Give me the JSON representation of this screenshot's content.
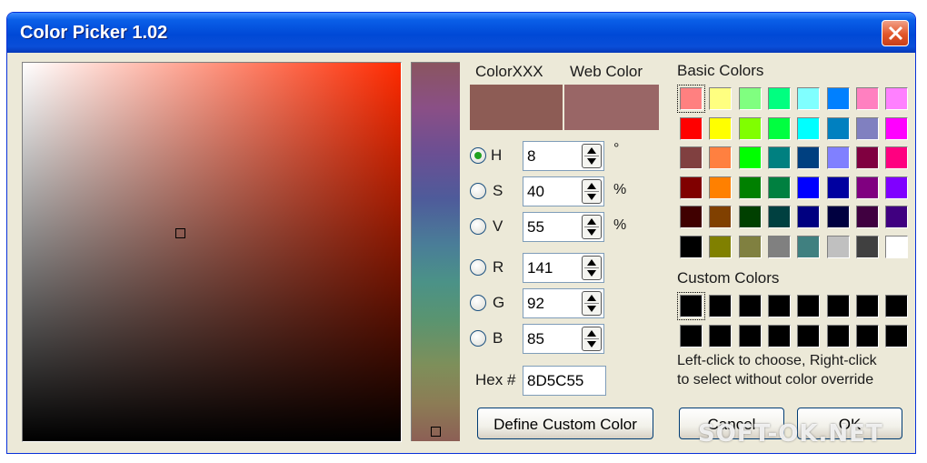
{
  "window": {
    "title": "Color Picker 1.02"
  },
  "preview": {
    "current_label": "ColorXXX",
    "web_label": "Web Color",
    "current_color": "#8d5c55",
    "web_color": "#996666"
  },
  "hue_color": "#ff2a00",
  "fields": {
    "h": {
      "label": "H",
      "value": "8",
      "unit": "°",
      "checked": true
    },
    "s": {
      "label": "S",
      "value": "40",
      "unit": "%"
    },
    "v": {
      "label": "V",
      "value": "55",
      "unit": "%"
    },
    "r": {
      "label": "R",
      "value": "141"
    },
    "g": {
      "label": "G",
      "value": "92"
    },
    "b": {
      "label": "B",
      "value": "85"
    }
  },
  "hex": {
    "label": "Hex #",
    "value": "8D5C55"
  },
  "basic_colors": {
    "label": "Basic Colors",
    "colors": [
      "#ff8080",
      "#ffff80",
      "#80ff80",
      "#00ff80",
      "#80ffff",
      "#0080ff",
      "#ff80c0",
      "#ff80ff",
      "#ff0000",
      "#ffff00",
      "#80ff00",
      "#00ff40",
      "#00ffff",
      "#0080c0",
      "#8080c0",
      "#ff00ff",
      "#804040",
      "#ff8040",
      "#00ff00",
      "#008080",
      "#004080",
      "#8080ff",
      "#800040",
      "#ff0080",
      "#800000",
      "#ff8000",
      "#008000",
      "#008040",
      "#0000ff",
      "#0000a0",
      "#800080",
      "#8000ff",
      "#400000",
      "#804000",
      "#004000",
      "#004040",
      "#000080",
      "#000040",
      "#400040",
      "#400080",
      "#000000",
      "#808000",
      "#808040",
      "#808080",
      "#408080",
      "#c0c0c0",
      "#404040",
      "#ffffff"
    ]
  },
  "custom_colors": {
    "label": "Custom Colors",
    "colors": [
      "#000000",
      "#000000",
      "#000000",
      "#000000",
      "#000000",
      "#000000",
      "#000000",
      "#000000",
      "#000000",
      "#000000",
      "#000000",
      "#000000",
      "#000000",
      "#000000",
      "#000000",
      "#000000"
    ]
  },
  "hint": {
    "line1": "Left-click to choose, Right-click",
    "line2": "to select without color override"
  },
  "buttons": {
    "define_custom": "Define Custom Color",
    "cancel": "Cancel",
    "ok": "OK"
  },
  "watermark": "SOFT-OK.NET"
}
